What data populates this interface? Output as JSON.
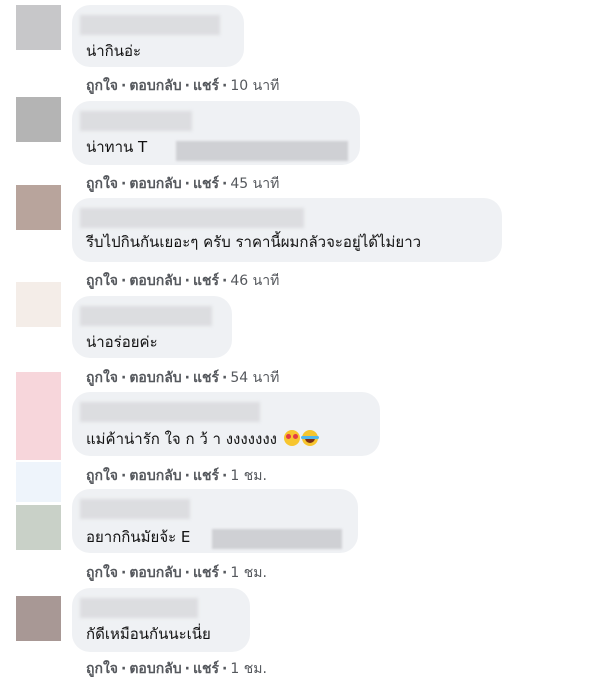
{
  "actions": {
    "like": "ถูกใจ",
    "reply": "ตอบกลับ",
    "share": "แชร์",
    "separator": "·"
  },
  "comments": [
    {
      "text": "น่ากินอ่ะ",
      "time": "10 นาที"
    },
    {
      "text": "น่าทาน T",
      "time": "45 นาที"
    },
    {
      "text": "รีบไปกินกันเยอะๆ ครับ ราคานี้ผมกลัวจะอยู่ได้ไม่ยาว",
      "time": "46 นาที"
    },
    {
      "text": "น่าอร่อยค่ะ",
      "time": "54 นาที"
    },
    {
      "text": "แม่ค้าน่ารัก ใจ ก ว้ า งงงงงงง",
      "time": "1 ชม."
    },
    {
      "text": "อยากกินมัยจ้ะ E",
      "time": "1 ชม."
    },
    {
      "text": "กัดีเหมือนกันนะเนี่ย",
      "time": "1 ชม."
    }
  ],
  "colors": {
    "avatars": [
      "#c7c7c9",
      "#b4b4b4",
      "#b8a49c",
      "#f4ede8",
      "#f7d6db",
      "#eef4fb",
      "#c9d1c8",
      "#a89895"
    ]
  },
  "emoji": [
    "heart-eyes-icon",
    "tears-of-joy-icon"
  ]
}
